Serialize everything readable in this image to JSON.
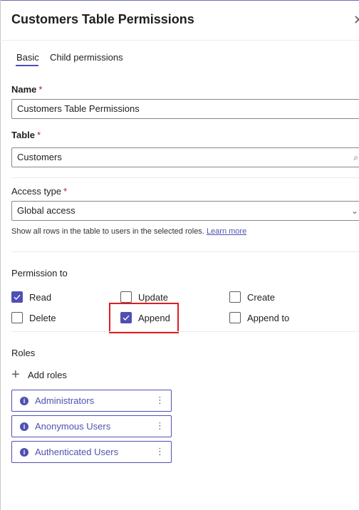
{
  "panel": {
    "title": "Customers Table Permissions",
    "tabs": [
      {
        "label": "Basic",
        "active": true
      },
      {
        "label": "Child permissions",
        "active": false
      }
    ]
  },
  "form": {
    "name": {
      "label": "Name",
      "required": "*",
      "value": "Customers Table Permissions"
    },
    "table": {
      "label": "Table",
      "required": "*",
      "value": "Customers"
    },
    "access_type": {
      "label": "Access type",
      "required": "*",
      "value": "Global access",
      "hint": "Show all rows in the table to users in the selected roles.",
      "learn_more": "Learn more"
    },
    "permissions": {
      "label": "Permission to",
      "items": [
        {
          "label": "Read",
          "checked": true
        },
        {
          "label": "Update",
          "checked": false
        },
        {
          "label": "Create",
          "checked": false
        },
        {
          "label": "Delete",
          "checked": false
        },
        {
          "label": "Append",
          "checked": true
        },
        {
          "label": "Append to",
          "checked": false
        }
      ]
    },
    "roles": {
      "label": "Roles",
      "add_label": "Add roles",
      "items": [
        {
          "label": "Administrators"
        },
        {
          "label": "Anonymous Users"
        },
        {
          "label": "Authenticated Users"
        }
      ]
    }
  },
  "colors": {
    "accent": "#4f4fb4",
    "highlight": "#e01b22",
    "required": "#a4262c"
  },
  "icons": {
    "close": "close-icon",
    "search": "search-icon",
    "dropdown": "chevron-down-icon",
    "add": "plus-icon",
    "info": "info-icon",
    "more": "more-vertical-icon",
    "check": "check-icon"
  }
}
